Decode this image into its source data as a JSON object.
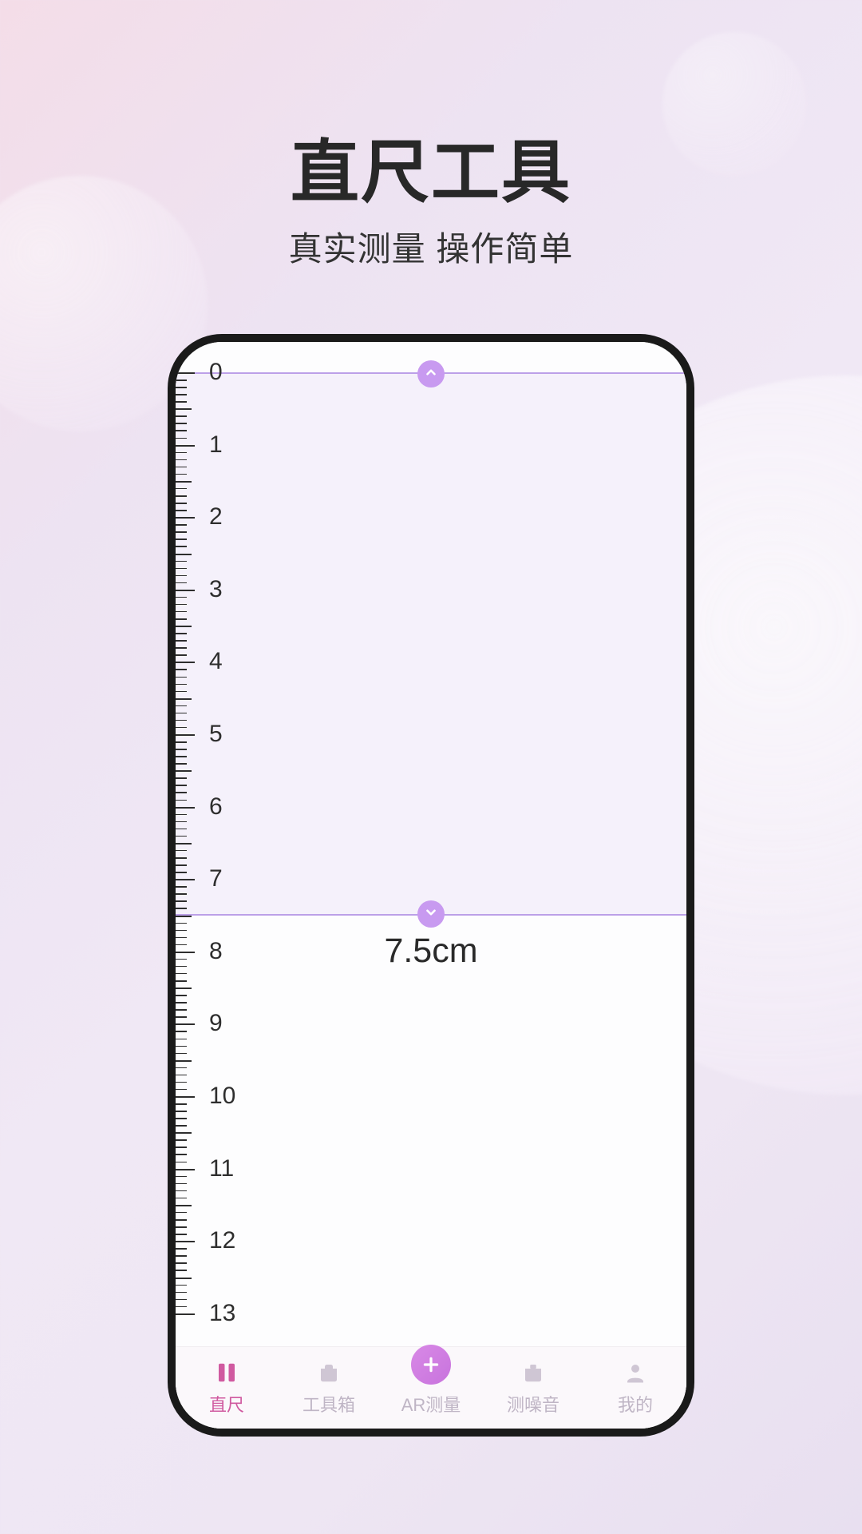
{
  "title": "直尺工具",
  "subtitle": "真实测量 操作简单",
  "ruler": {
    "marks": [
      "0",
      "1",
      "2",
      "3",
      "4",
      "5",
      "6",
      "7",
      "8",
      "9",
      "10",
      "11",
      "12",
      "13"
    ],
    "measurement": "7.5cm",
    "selection_start_cm": 0,
    "selection_end_cm": 7.5
  },
  "tabs": [
    {
      "key": "ruler",
      "label": "直尺",
      "active": true
    },
    {
      "key": "tools",
      "label": "工具箱",
      "active": false
    },
    {
      "key": "ar",
      "label": "AR测量",
      "active": false
    },
    {
      "key": "noise",
      "label": "测噪音",
      "active": false
    },
    {
      "key": "me",
      "label": "我的",
      "active": false
    }
  ],
  "colors": {
    "accent": "#c89af0",
    "tab_active": "#d05aa0",
    "tab_inactive": "#bfb5c5"
  }
}
